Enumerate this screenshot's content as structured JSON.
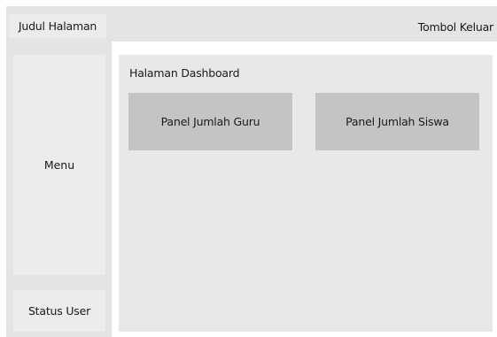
{
  "header": {
    "page_title": "Judul Halaman",
    "logout_label": "Tombol Keluar"
  },
  "sidebar": {
    "menu_label": "Menu",
    "status_label": "Status User"
  },
  "main": {
    "title": "Halaman Dashboard",
    "panels": [
      {
        "label": "Panel Jumlah Guru"
      },
      {
        "label": "Panel Jumlah Siswa"
      }
    ]
  },
  "colors": {
    "frame_gray": "#e4e4e4",
    "box_gray": "#ececec",
    "panel_gray": "#c4c4c4"
  }
}
